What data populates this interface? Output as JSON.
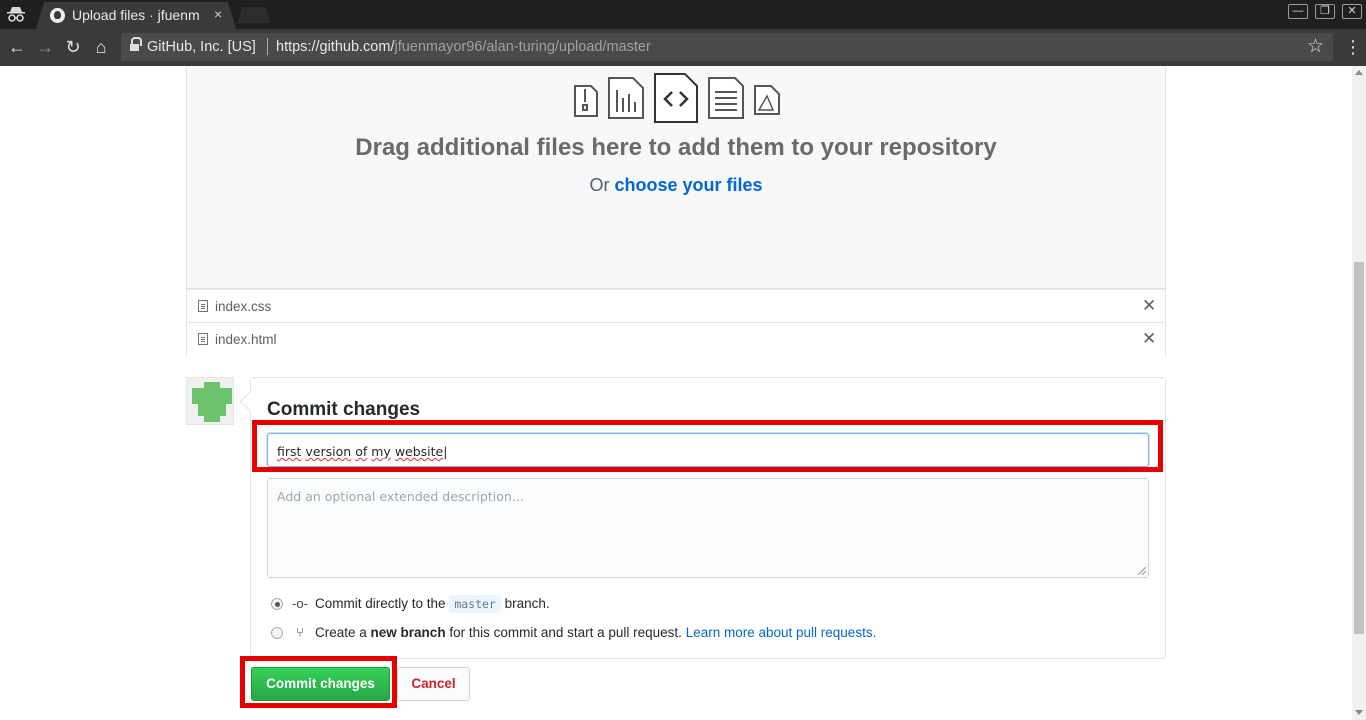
{
  "browser": {
    "tab_title": "Upload files · jfuenm",
    "tab_close": "×",
    "window_controls": {
      "minimize": "—",
      "restore": "❐",
      "close": "✕"
    },
    "org_label": "GitHub, Inc. [US]",
    "url_prefix": "https://github.com/",
    "url_path": "jfuenmayor96/alan-turing/upload/master",
    "nav_icons": {
      "back": "←",
      "forward": "→",
      "reload": "↻",
      "home": "⌂",
      "star": "☆",
      "menu": "⋮"
    }
  },
  "dropzone": {
    "title": "Drag additional files here to add them to your repository",
    "or_text": "Or",
    "choose_link": "choose your files",
    "file_type_icons": [
      "zip-file-icon",
      "chart-file-icon",
      "code-file-icon",
      "text-file-icon",
      "pdf-file-icon"
    ]
  },
  "files": [
    {
      "name": "index.css",
      "remove": "✕"
    },
    {
      "name": "index.html",
      "remove": "✕"
    }
  ],
  "commit": {
    "heading": "Commit changes",
    "summary_value": "first version of my website",
    "summary_words": [
      "first",
      "version",
      "of",
      "my",
      "website"
    ],
    "description_placeholder": "Add an optional extended description…",
    "option_direct": {
      "prefix": "Commit directly to the",
      "branch": "master",
      "suffix": "branch."
    },
    "option_new_branch": {
      "prefix": "Create a",
      "bold": "new branch",
      "middle": "for this commit and start a pull request.",
      "link": "Learn more about pull requests."
    },
    "selected_option": "direct",
    "commit_button": "Commit changes",
    "cancel_button": "Cancel"
  },
  "colors": {
    "primary_green": "#28a745",
    "link_blue": "#0366d6",
    "danger_red": "#cb2431",
    "highlight_red": "#e60000"
  }
}
